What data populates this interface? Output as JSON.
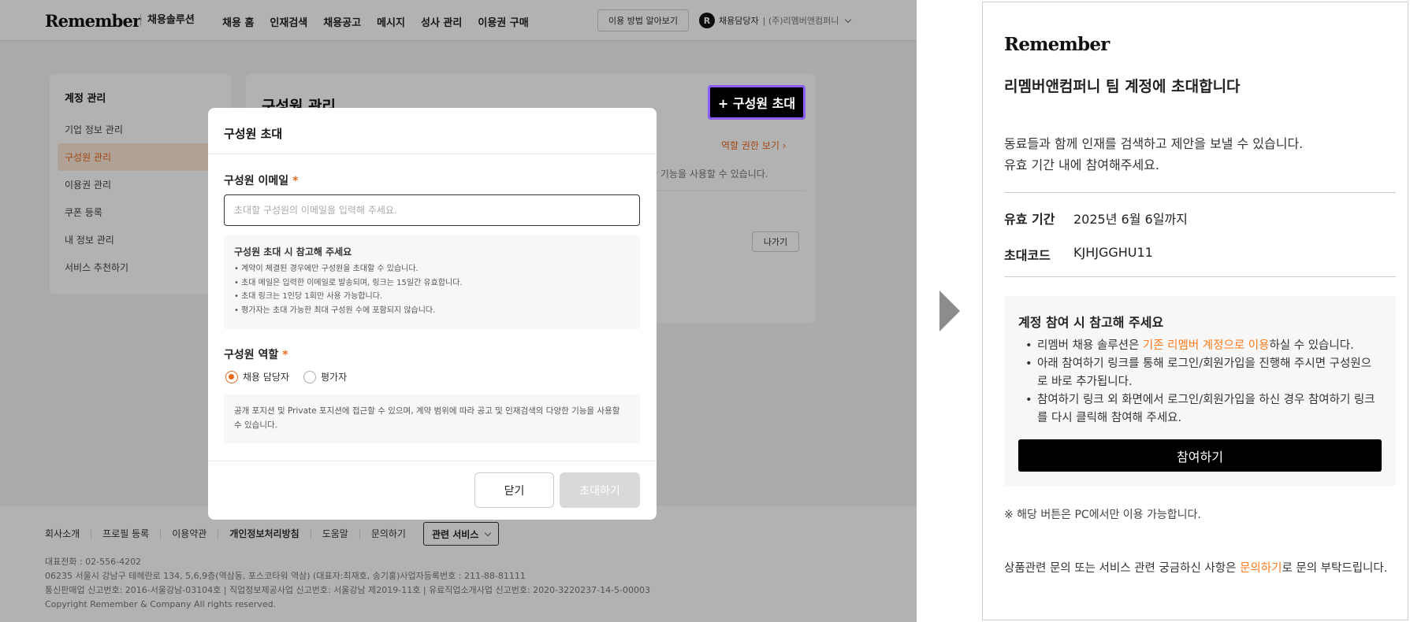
{
  "app": {
    "logo": "Remember",
    "logo_sub": "채용솔루션",
    "nav": [
      "채용 홈",
      "인재검색",
      "채용공고",
      "메시지",
      "성사 관리",
      "이용권 구매"
    ],
    "guide_button": "이용 방법 알아보기",
    "user_avatar": "R",
    "user_role": "채용담당자",
    "user_company": "(주)리멤버앤컴퍼니"
  },
  "sidebar": {
    "title": "계정 관리",
    "items": [
      "기업 정보 관리",
      "구성원 관리",
      "이용권 관리",
      "쿠폰 등록",
      "내 정보 관리",
      "서비스 추천하기"
    ],
    "active_index": 1
  },
  "content": {
    "title": "구성원 관리",
    "invite_button": "+ 구성원 초대",
    "role_link": "역할 권한 보기",
    "desc": "양한 기능을 사용할 수 있습니다.",
    "leave_button": "나가기"
  },
  "modal": {
    "title": "구성원 초대",
    "email_label": "구성원 이메일",
    "required_mark": "*",
    "email_placeholder": "초대할 구성원의 이메일을 입력해 주세요.",
    "note_title": "구성원 초대 시 참고해 주세요",
    "notes": [
      "• 계약이 체결된 경우에만 구성원을 초대할 수 있습니다.",
      "• 초대 메일은 입력한 이메일로 발송되며, 링크는 15일간 유효합니다.",
      "• 초대 링크는 1인당 1회만 사용 가능합니다.",
      "• 평가자는 초대 가능한 최대 구성원 수에 포함되지 않습니다."
    ],
    "role_label": "구성원 역할",
    "roles": [
      "채용 담당자",
      "평가자"
    ],
    "selected_role": "채용 담당자",
    "role_desc": "공개 포지션 및 Private 포지션에 접근할 수 있으며, 계약 범위에 따라 공고 및 인재검색의 다양한 기능을 사용할 수 있습니다.",
    "close_button": "닫기",
    "submit_button": "초대하기"
  },
  "footer": {
    "links": [
      "회사소개",
      "프로필 등록",
      "이용약관",
      "개인정보처리방침",
      "도움말",
      "문의하기"
    ],
    "related_button": "관련 서비스",
    "info_lines": [
      "대표전화 : 02-556-4202",
      "06235 서울시 강남구 테헤란로 134, 5,6,9층(역삼동, 포스코타워 역삼) (대표자:최재호, 송기홍)사업자등록번호 : 211-88-81111",
      "통신판매업 신고번호: 2016-서울강남-03104호 | 직업정보제공사업 신고번호: 서울강남 제2019-11호 | 유료직업소개사업 신고번호: 2020-3220237-14-5-00003",
      "Copyright Remember & Company All rights reserved."
    ]
  },
  "email": {
    "logo": "Remember",
    "heading": "리멤버앤컴퍼니 팀 계정에 초대합니다",
    "intro_lines": [
      "동료들과 함께 인재를 검색하고 제안을 보낼 수 있습니다.",
      "유효 기간 내에 참여해주세요."
    ],
    "valid_label": "유효 기간",
    "valid_value": "2025년 6월 6일까지",
    "code_label": "초대코드",
    "code_value": "KJHJGGHU11",
    "guide_title": "계정 참여 시 참고해 주세요",
    "guide_item1_pre": "리멤버 채용 솔루션은 ",
    "guide_item1_highlight": "기존 리멤버 계정으로 이용",
    "guide_item1_post": "하실 수 있습니다.",
    "guide_item2": "아래 참여하기 링크를 통해 로그인/회원가입을 진행해 주시면 구성원으로 바로 추가됩니다.",
    "guide_item3": "참여하기 링크 외 화면에서 로그인/회원가입을 하신 경우 참여하기 링크를 다시 클릭해 참여해 주세요.",
    "join_button": "참여하기",
    "pc_note": "※ 해당 버튼은 PC에서만 이용 가능합니다.",
    "inquiry_pre": "상품관련 문의 또는 서비스 관련 궁금하신 사항은 ",
    "inquiry_link": "문의하기",
    "inquiry_post": "로 문의 부탁드립니다.",
    "accent_color": "#ff7a1a"
  }
}
